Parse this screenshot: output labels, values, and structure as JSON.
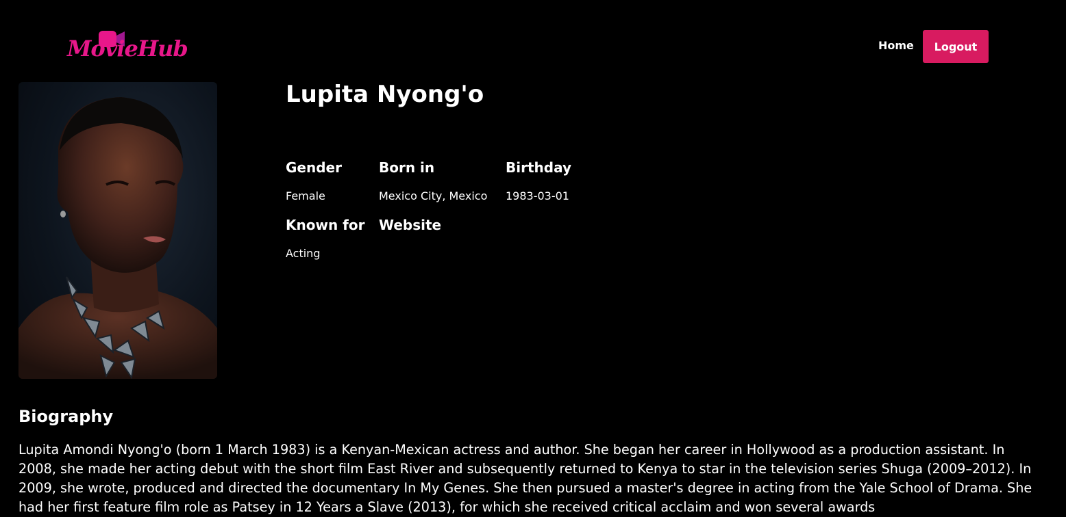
{
  "header": {
    "logo_text": "MovieHub",
    "nav_home": "Home",
    "logout_label": "Logout"
  },
  "person": {
    "name": "Lupita Nyong'o",
    "gender_label": "Gender",
    "gender": "Female",
    "born_in_label": "Born in",
    "born_in": "Mexico City, Mexico",
    "birthday_label": "Birthday",
    "birthday": "1983-03-01",
    "known_for_label": "Known for",
    "known_for": "Acting",
    "website_label": "Website",
    "website": ""
  },
  "biography": {
    "title": "Biography",
    "text": "Lupita Amondi Nyong'o (born 1 March 1983) is a Kenyan-Mexican actress and author. She began her career in Hollywood as a production assistant. In 2008, she made her acting debut with the short film East River and subsequently returned to Kenya to star in the television series Shuga (2009–2012). In 2009, she wrote, produced and directed the documentary In My Genes. She then pursued a master's degree in acting from the Yale School of Drama. She had her first feature film role as Patsey in 12 Years a Slave (2013), for which she received critical acclaim and won several awards"
  },
  "colors": {
    "background": "#000000",
    "accent": "#d81b60",
    "logo": "#e8178a",
    "logo_camera": "#b5179e"
  },
  "icons": {
    "logo_camera": "video-camera-icon"
  }
}
